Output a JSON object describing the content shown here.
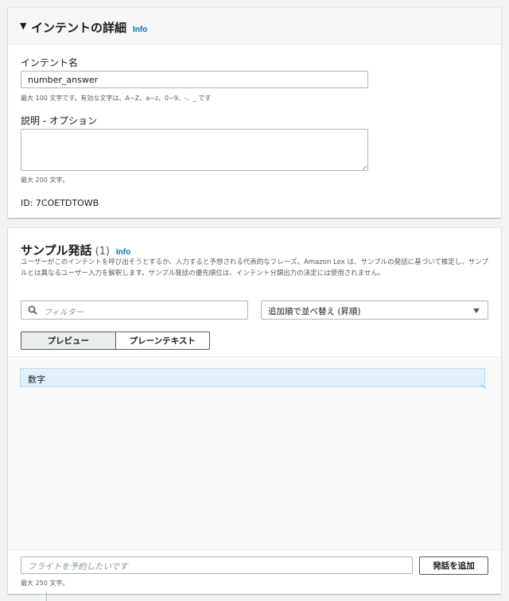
{
  "intent_details": {
    "title": "インテントの詳細",
    "info_link": "Info",
    "name_label": "インテント名",
    "name_value": "number_answer",
    "name_hint": "最大 100 文字です。有効な文字は、A~Z、a~z、0~9、-、_ です",
    "description_label": "説明 - オプション",
    "description_value": "",
    "description_hint": "最大 200 文字。",
    "id_text": "ID: 7COETDTOWB"
  },
  "sample_utterances": {
    "title": "サンプル発話",
    "count": "(1)",
    "info_link": "Info",
    "description": "ユーザーがこのインテントを呼び出そうとするか、入力すると予想される代表的なフレーズ。Amazon Lex は、サンプルの発話に基づいて推定し、サンプルとは異なるユーザー入力を解釈します。サンプル発話の優先順位は、インテント分類出力の決定には使用されません。",
    "filter_placeholder": "フィルター",
    "sort_selected": "追加順で並べ替え (昇順)",
    "tabs": [
      "プレビュー",
      "プレーンテキスト"
    ],
    "utterances": [
      "数字"
    ],
    "new_placeholder": "フライトを予約したいです",
    "add_button": "発話を追加",
    "new_hint": "最大 250 文字。"
  }
}
